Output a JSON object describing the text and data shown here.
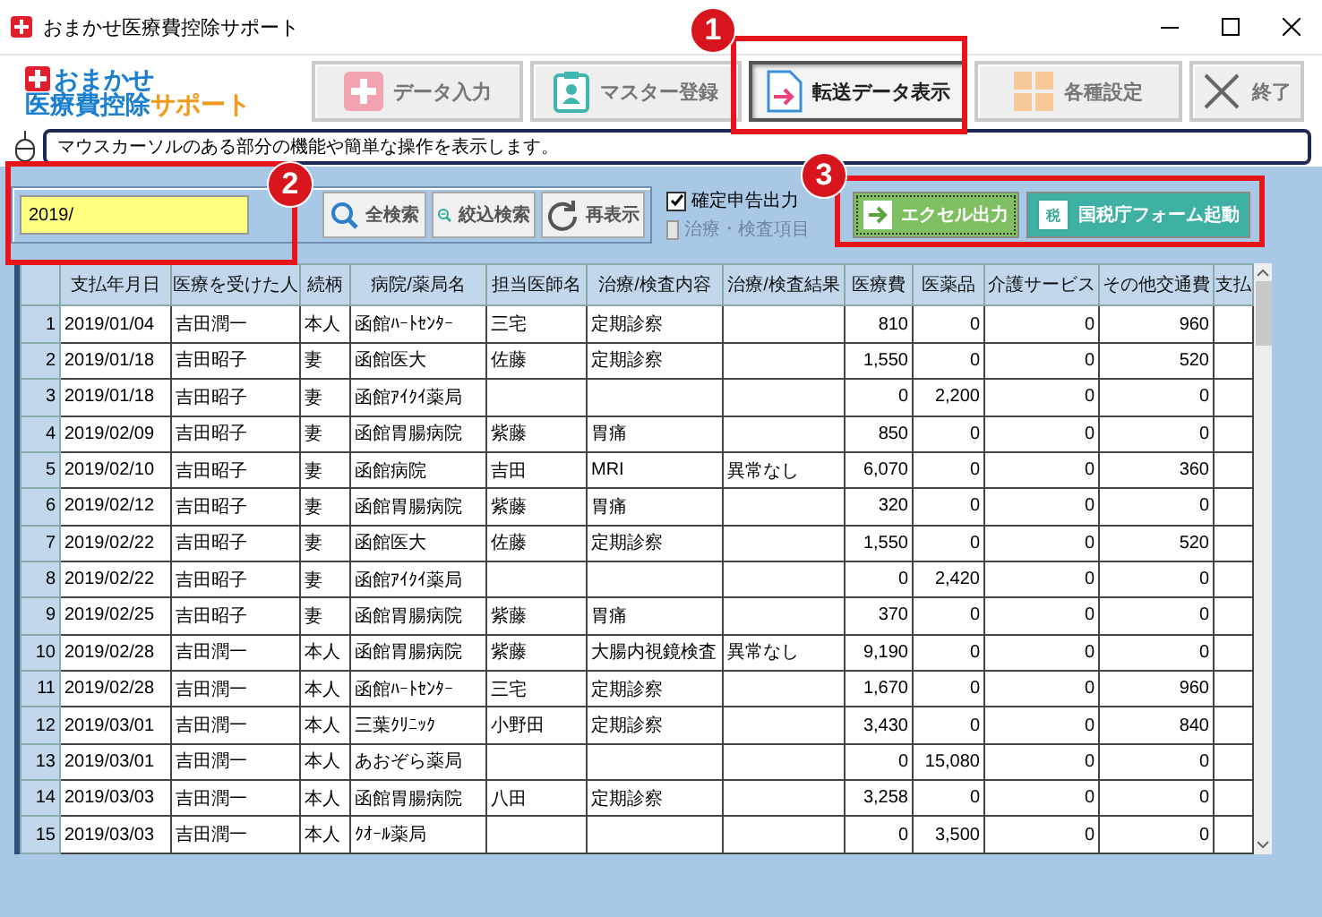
{
  "window": {
    "title": "おまかせ医療費控除サポート"
  },
  "logo": {
    "line_1": "おまかせ",
    "line_2a": "医療費控除",
    "line_2b": "サポート"
  },
  "toolbar": [
    {
      "label": "データ入力",
      "kind": "add",
      "selected": false
    },
    {
      "label": "マスター登録",
      "kind": "master",
      "selected": false
    },
    {
      "label": "転送データ表示",
      "kind": "transfer",
      "selected": true
    },
    {
      "label": "各種設定",
      "kind": "settings",
      "selected": false
    },
    {
      "label": "終了",
      "kind": "exit",
      "selected": false
    }
  ],
  "hint": {
    "text": "マウスカーソルのある部分の機能や簡単な操作を表示します。"
  },
  "search": {
    "value": "2019/",
    "buttons": [
      {
        "label": "全検索",
        "kind": "search"
      },
      {
        "label": "絞込検索",
        "kind": "filter"
      },
      {
        "label": "再表示",
        "kind": "refresh"
      }
    ]
  },
  "options": [
    {
      "label": "確定申告出力",
      "checked": true,
      "disabled": false
    },
    {
      "label": "治療・検査項目",
      "checked": false,
      "disabled": true
    }
  ],
  "export_buttons": [
    {
      "label": "エクセル出力",
      "kind": "excel"
    },
    {
      "label": "国税庁フォーム起動",
      "kind": "tax",
      "icon_text": "税"
    }
  ],
  "table": {
    "columns": [
      "支払年月日",
      "医療を受けた人",
      "続柄",
      "病院/薬局名",
      "担当医師名",
      "治療/検査内容",
      "治療/検査結果",
      "医療費",
      "医薬品",
      "介護サービス",
      "その他交通費",
      "支払"
    ],
    "rows": [
      {
        "number": "1",
        "cells": [
          "2019/01/04",
          "吉田潤一",
          "本人",
          "函館ﾊｰﾄｾﾝﾀｰ",
          "三宅",
          "定期診察",
          "",
          "810",
          "0",
          "0",
          "960",
          ""
        ]
      },
      {
        "number": "2",
        "cells": [
          "2019/01/18",
          "吉田昭子",
          "妻",
          "函館医大",
          "佐藤",
          "定期診察",
          "",
          "1,550",
          "0",
          "0",
          "520",
          ""
        ]
      },
      {
        "number": "3",
        "cells": [
          "2019/01/18",
          "吉田昭子",
          "妻",
          "函館ｱｲｸｲ薬局",
          "",
          "",
          "",
          "0",
          "2,200",
          "0",
          "0",
          ""
        ]
      },
      {
        "number": "4",
        "cells": [
          "2019/02/09",
          "吉田昭子",
          "妻",
          "函館胃腸病院",
          "紫藤",
          "胃痛",
          "",
          "850",
          "0",
          "0",
          "0",
          ""
        ]
      },
      {
        "number": "5",
        "cells": [
          "2019/02/10",
          "吉田昭子",
          "妻",
          "函館病院",
          "吉田",
          "MRI",
          "異常なし",
          "6,070",
          "0",
          "0",
          "360",
          ""
        ]
      },
      {
        "number": "6",
        "cells": [
          "2019/02/12",
          "吉田昭子",
          "妻",
          "函館胃腸病院",
          "紫藤",
          "胃痛",
          "",
          "320",
          "0",
          "0",
          "0",
          ""
        ]
      },
      {
        "number": "7",
        "cells": [
          "2019/02/22",
          "吉田昭子",
          "妻",
          "函館医大",
          "佐藤",
          "定期診察",
          "",
          "1,550",
          "0",
          "0",
          "520",
          ""
        ]
      },
      {
        "number": "8",
        "cells": [
          "2019/02/22",
          "吉田昭子",
          "妻",
          "函館ｱｲｸｲ薬局",
          "",
          "",
          "",
          "0",
          "2,420",
          "0",
          "0",
          ""
        ]
      },
      {
        "number": "9",
        "cells": [
          "2019/02/25",
          "吉田昭子",
          "妻",
          "函館胃腸病院",
          "紫藤",
          "胃痛",
          "",
          "370",
          "0",
          "0",
          "0",
          ""
        ]
      },
      {
        "number": "10",
        "cells": [
          "2019/02/28",
          "吉田潤一",
          "本人",
          "函館胃腸病院",
          "紫藤",
          "大腸内視鏡検査",
          "異常なし",
          "9,190",
          "0",
          "0",
          "0",
          ""
        ]
      },
      {
        "number": "11",
        "cells": [
          "2019/02/28",
          "吉田潤一",
          "本人",
          "函館ﾊｰﾄｾﾝﾀｰ",
          "三宅",
          "定期診察",
          "",
          "1,670",
          "0",
          "0",
          "960",
          ""
        ]
      },
      {
        "number": "12",
        "cells": [
          "2019/03/01",
          "吉田潤一",
          "本人",
          "三葉ｸﾘﾆｯｸ",
          "小野田",
          "定期診察",
          "",
          "3,430",
          "0",
          "0",
          "840",
          ""
        ]
      },
      {
        "number": "13",
        "cells": [
          "2019/03/01",
          "吉田潤一",
          "本人",
          "あおぞら薬局",
          "",
          "",
          "",
          "0",
          "15,080",
          "0",
          "0",
          ""
        ]
      },
      {
        "number": "14",
        "cells": [
          "2019/03/03",
          "吉田潤一",
          "本人",
          "函館胃腸病院",
          "八田",
          "定期診察",
          "",
          "3,258",
          "0",
          "0",
          "0",
          ""
        ]
      },
      {
        "number": "15",
        "cells": [
          "2019/03/03",
          "吉田潤一",
          "本人",
          "ｸｵｰﾙ薬局",
          "",
          "",
          "",
          "0",
          "3,500",
          "0",
          "0",
          ""
        ]
      }
    ]
  },
  "callouts": [
    {
      "number": "1"
    },
    {
      "number": "2"
    },
    {
      "number": "3"
    }
  ]
}
